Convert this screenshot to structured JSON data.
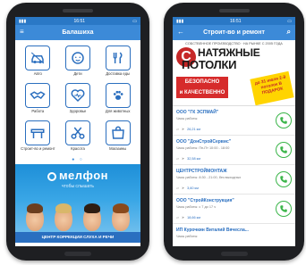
{
  "left_phone": {
    "status_time": "16:51",
    "app_title": "Балашиха",
    "menu_icon": "hamburger-icon",
    "categories": [
      {
        "label": "Авто",
        "icon": "car-icon"
      },
      {
        "label": "Дети",
        "icon": "baby-icon"
      },
      {
        "label": "Доставка еды",
        "icon": "food-delivery-icon"
      },
      {
        "label": "Работа",
        "icon": "handshake-icon"
      },
      {
        "label": "Здоровье",
        "icon": "heart-icon"
      },
      {
        "label": "Для животных",
        "icon": "paw-icon"
      },
      {
        "label": "Строит-во и ремонт",
        "icon": "tools-icon"
      },
      {
        "label": "Красота",
        "icon": "scissors-icon"
      },
      {
        "label": "Магазины",
        "icon": "shop-icon"
      }
    ],
    "banner": {
      "brand": "мелфон",
      "slogan": "чтобы слышать",
      "footer": "ЦЕНТР КОРРЕКЦИИ СЛУХА И РЕЧИ"
    }
  },
  "right_phone": {
    "status_time": "16:51",
    "app_title": "Строит-во и ремонт",
    "ad": {
      "top_line": "СОБСТВЕННОЕ ПРОИЗВОДСТВО · НА РЫНКЕ С 2005 ГОДА",
      "logo_letter": "С",
      "title_line1": "НАТЯЖНЫЕ",
      "title_line2": "ПОТОЛКИ",
      "quality_line1": "БЕЗОПАСНО",
      "quality_line2": "и КАЧЕСТВЕННО",
      "promo": "до 31 июля 2-й потолок В ПОДАРОК"
    },
    "companies": [
      {
        "name": "ООО \"ГК ЭСПМАЙ\"",
        "hours": "Часы работы:",
        "distance": "26,21 км"
      },
      {
        "name": "ООО \"ДонСтройСервис\"",
        "hours": "Часы работы: Пн-Пт 10:00 - 18:00",
        "distance": "32,58 км"
      },
      {
        "name": "ЦЕНТРСТРОЙМОНТАЖ",
        "hours": "Часы работы: 8:30 - 21:00, без выходных",
        "distance": "3,60 км"
      },
      {
        "name": "ООО \"СтройКонструкция\"",
        "hours": "Часы работы: с 7 до 17 ч",
        "distance": "18,66 км"
      },
      {
        "name": "ИП Курочкин Виталий Вячесла...",
        "hours": "Часы работы:",
        "distance": ""
      }
    ]
  },
  "colors": {
    "accent": "#3c8ad8",
    "status_bar": "#2a78c6",
    "call_green": "#3bb54a"
  }
}
